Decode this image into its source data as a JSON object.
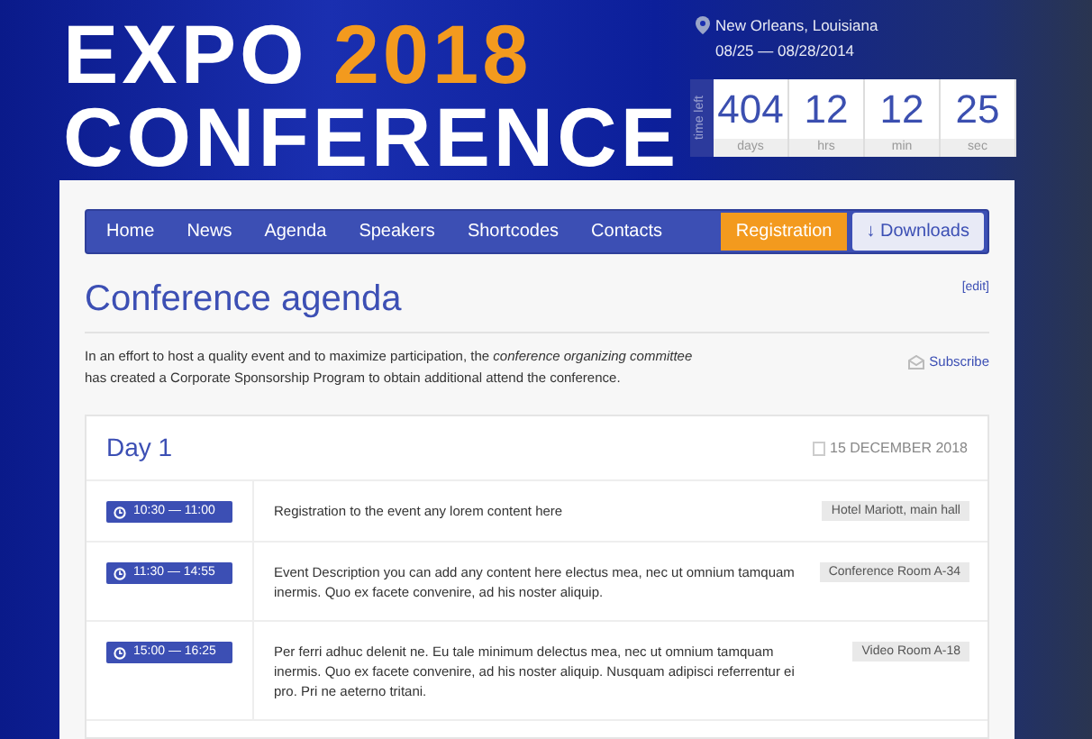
{
  "header": {
    "title_parts": [
      {
        "text": "EXPO",
        "kind": "plain"
      },
      {
        "text": "2018",
        "kind": "accent"
      }
    ],
    "subtitle": "CONFERENCE",
    "location": "New Orleans, Louisiana",
    "dates": "08/25 — 08/28/2014"
  },
  "countdown": {
    "label": "time left",
    "units": [
      {
        "value": "404",
        "unit": "days"
      },
      {
        "value": "12",
        "unit": "hrs"
      },
      {
        "value": "12",
        "unit": "min"
      },
      {
        "value": "25",
        "unit": "sec"
      }
    ]
  },
  "nav": {
    "items": [
      {
        "label": "Home",
        "kind": "link"
      },
      {
        "label": "News",
        "kind": "link"
      },
      {
        "label": "Agenda",
        "kind": "link"
      },
      {
        "label": "Speakers",
        "kind": "link"
      },
      {
        "label": "Shortcodes",
        "kind": "link"
      },
      {
        "label": "Contacts",
        "kind": "link"
      },
      {
        "label": "Registration",
        "kind": "highlight"
      },
      {
        "label": "↓ Downloads",
        "kind": "light"
      }
    ]
  },
  "page": {
    "title": "Conference agenda",
    "edit": "[edit]",
    "intro": "In an effort to host a quality event and to maximize participation, the *conference organizing committee* has created a Corporate Sponsorship Program to obtain additional attend the conference.",
    "subscribe": "Subscribe"
  },
  "agenda": {
    "day": "Day 1",
    "date": "15 DECEMBER 2018",
    "sessions": [
      {
        "time": "10:30 — 11:00",
        "description": "Registration to the event any lorem content here",
        "room": "Hotel Mariott, main hall"
      },
      {
        "time": "11:30 — 14:55",
        "description": "Event Description you can add any content here electus mea, nec ut omnium tamquam inermis. Quo ex facete convenire, ad his noster aliquip.",
        "room": "Conference Room A-34"
      },
      {
        "time": "15:00 — 16:25",
        "description": "Per ferri adhuc delenit ne. Eu tale minimum delectus mea, nec ut omnium tamquam inermis. Quo ex facete convenire, ad his noster aliquip. Nusquam adipisci referrentur ei pro. Pri ne aeterno tritani.",
        "room": "Video Room A-18"
      }
    ]
  }
}
